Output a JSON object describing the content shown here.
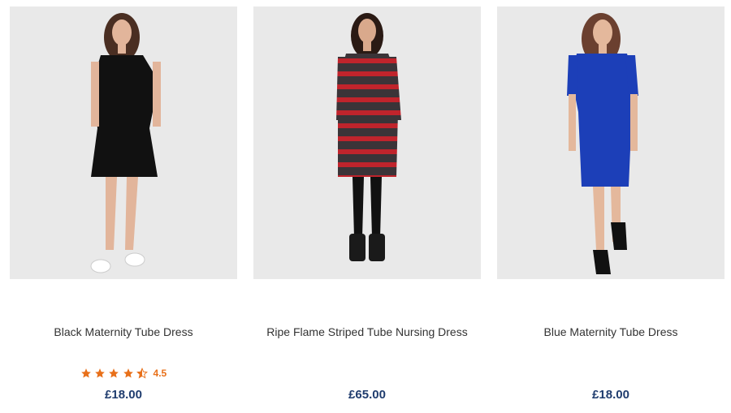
{
  "products": [
    {
      "image": "model-in-black-dress",
      "name": "Black Maternity Tube Dress",
      "rating": "4.5",
      "stars": 4.5,
      "price": "£18.00"
    },
    {
      "image": "model-in-striped-dress",
      "name": "Ripe Flame Striped Tube Nursing Dress",
      "price": "£65.00"
    },
    {
      "image": "model-in-blue-dress",
      "name": "Blue Maternity Tube Dress",
      "price": "£18.00"
    }
  ],
  "colors": {
    "price": "#1f3c6e",
    "rating": "#e8701a",
    "photo_background": "#e9e9e9"
  }
}
